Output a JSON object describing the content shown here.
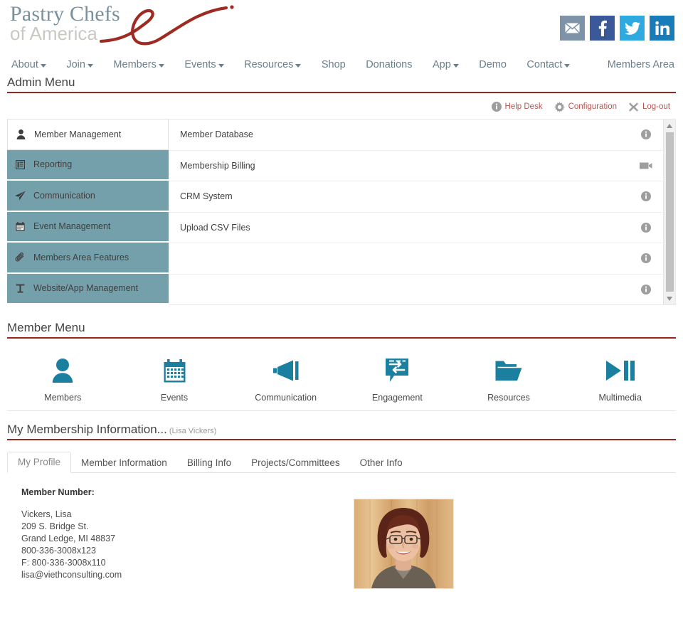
{
  "brand": {
    "line1": "Pastry Chefs",
    "line2": "of America",
    "accent_red": "#96271f",
    "logo_blue": "#7a909c",
    "teal": "#74a0ab",
    "icon_blue": "#1b7fa0"
  },
  "social": [
    {
      "name": "email-icon",
      "label": "Email",
      "color": "#7e93a8"
    },
    {
      "name": "facebook-icon",
      "label": "Facebook",
      "color": "#3b5998"
    },
    {
      "name": "twitter-icon",
      "label": "Twitter",
      "color": "#2eaae0"
    },
    {
      "name": "linkedin-icon",
      "label": "LinkedIn",
      "color": "#1a7bb9"
    }
  ],
  "nav": {
    "items": [
      {
        "label": "About",
        "caret": true
      },
      {
        "label": "Join",
        "caret": true
      },
      {
        "label": "Members",
        "caret": true
      },
      {
        "label": "Events",
        "caret": true
      },
      {
        "label": "Resources",
        "caret": true
      },
      {
        "label": "Shop",
        "caret": false
      },
      {
        "label": "Donations",
        "caret": false
      },
      {
        "label": "App",
        "caret": true
      },
      {
        "label": "Demo",
        "caret": false
      },
      {
        "label": "Contact",
        "caret": true
      }
    ],
    "members_area": "Members Area"
  },
  "admin": {
    "title": "Admin Menu",
    "actions": [
      {
        "icon": "info-circle-icon",
        "label": "Help Desk"
      },
      {
        "icon": "gear-icon",
        "label": "Configuration"
      },
      {
        "icon": "close-x-icon",
        "label": "Log-out"
      }
    ],
    "categories": [
      {
        "label": "Member Management",
        "icon": "user-icon",
        "active": true
      },
      {
        "label": "Reporting",
        "icon": "report-icon",
        "active": false
      },
      {
        "label": "Communication",
        "icon": "paper-plane-icon",
        "active": false
      },
      {
        "label": "Event Management",
        "icon": "calendar-icon",
        "active": false
      },
      {
        "label": "Members Area Features",
        "icon": "paperclip-icon",
        "active": false
      },
      {
        "label": "Website/App Management",
        "icon": "text-tool-icon",
        "active": false
      }
    ],
    "rows": [
      {
        "label": "Member Database",
        "icon": "info-circle-icon"
      },
      {
        "label": "Membership Billing",
        "icon": "video-camera-icon"
      },
      {
        "label": "CRM System",
        "icon": "info-circle-icon"
      },
      {
        "label": "Upload CSV Files",
        "icon": "info-circle-icon"
      },
      {
        "label": "",
        "icon": "info-circle-icon"
      },
      {
        "label": "",
        "icon": "info-circle-icon"
      }
    ]
  },
  "member_menu": {
    "title": "Member Menu",
    "items": [
      {
        "label": "Members",
        "icon": "user-icon"
      },
      {
        "label": "Events",
        "icon": "calendar-icon"
      },
      {
        "label": "Communication",
        "icon": "megaphone-icon"
      },
      {
        "label": "Engagement",
        "icon": "chat-exchange-icon"
      },
      {
        "label": "Resources",
        "icon": "folder-open-icon"
      },
      {
        "label": "Multimedia",
        "icon": "play-pause-icon"
      }
    ]
  },
  "membership": {
    "title": "My Membership Information...",
    "user": "(Lisa Vickers)",
    "tabs": [
      {
        "label": "My Profile",
        "active": true
      },
      {
        "label": "Member Information",
        "active": false
      },
      {
        "label": "Billing Info",
        "active": false
      },
      {
        "label": "Projects/Committees",
        "active": false
      },
      {
        "label": "Other Info",
        "active": false
      }
    ],
    "profile": {
      "member_number_label": "Member Number:",
      "name": "Vickers, Lisa",
      "street": "209 S. Bridge St.",
      "city_state_zip": "Grand Ledge, MI 48837",
      "phone": "800-336-3008x123",
      "fax": "F: 800-336-3008x110",
      "email": "lisa@viethconsulting.com",
      "photo_alt": "member-portrait"
    }
  }
}
